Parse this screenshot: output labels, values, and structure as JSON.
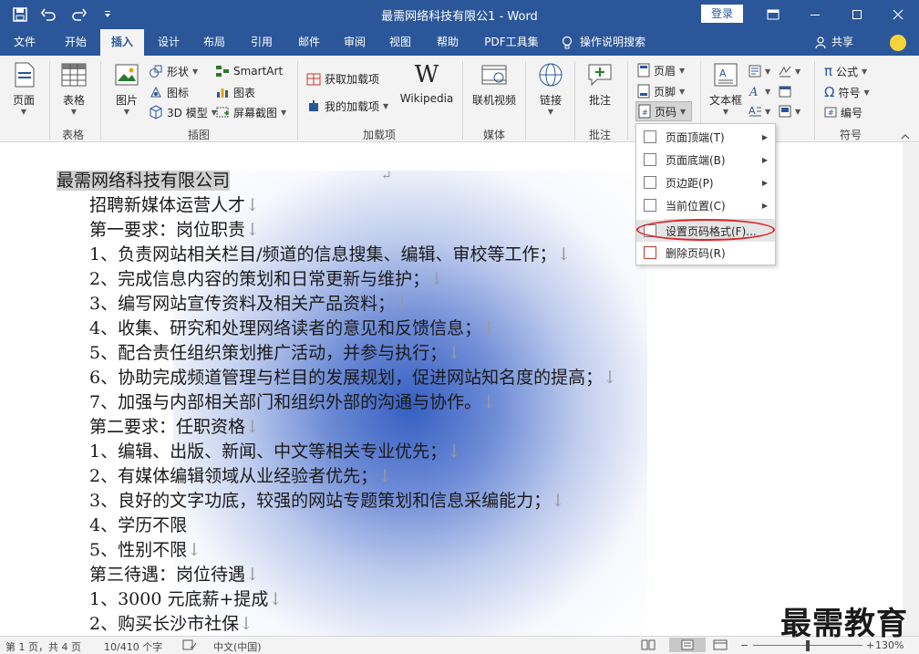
{
  "window": {
    "title": "最需网络科技有限公1 - Word",
    "login_label": "登录"
  },
  "tabs": [
    {
      "label": "文件"
    },
    {
      "label": "开始"
    },
    {
      "label": "插入"
    },
    {
      "label": "设计"
    },
    {
      "label": "布局"
    },
    {
      "label": "引用"
    },
    {
      "label": "邮件"
    },
    {
      "label": "审阅"
    },
    {
      "label": "视图"
    },
    {
      "label": "帮助"
    },
    {
      "label": "PDF工具集"
    }
  ],
  "tell_me": "操作说明搜索",
  "share": "共享",
  "ribbon": {
    "pages": {
      "label": "页面",
      "group": ""
    },
    "table": {
      "label": "表格",
      "group": "表格"
    },
    "picture": {
      "label": "图片"
    },
    "shapes": "形状",
    "icons": "图标",
    "model3d": "3D 模型",
    "smartart": "SmartArt",
    "chart": "图表",
    "screenshot": "屏幕截图",
    "illustrations_group": "插图",
    "get_addins": "获取加载项",
    "my_addins": "我的加载项",
    "wikipedia": "Wikipedia",
    "addins_group": "加载项",
    "online_video": "联机视频",
    "media_group": "媒体",
    "link": "链接",
    "comment": "批注",
    "comment_group": "批注",
    "header": "页眉",
    "footer": "页脚",
    "page_number": "页码",
    "textbox": "文本框",
    "equation": "公式",
    "symbol": "符号",
    "numbering": "编号",
    "symbols_group": "符号"
  },
  "menu": {
    "items": [
      {
        "label": "页面顶端(T)",
        "submenu": true
      },
      {
        "label": "页面底端(B)",
        "submenu": true
      },
      {
        "label": "页边距(P)",
        "submenu": true
      },
      {
        "label": "当前位置(C)",
        "submenu": true
      },
      {
        "label": "设置页码格式(F)...",
        "submenu": false
      },
      {
        "label": "删除页码(R)",
        "submenu": false
      }
    ]
  },
  "document": {
    "lines": [
      "最需网络科技有限公司",
      "招聘新媒体运营人才",
      "第一要求：岗位职责",
      "1、负责网站相关栏目/频道的信息搜集、编辑、审校等工作；",
      "2、完成信息内容的策划和日常更新与维护；",
      "3、编写网站宣传资料及相关产品资料；",
      "4、收集、研究和处理网络读者的意见和反馈信息；",
      "5、配合责任组织策划推广活动，并参与执行；",
      "6、协助完成频道管理与栏目的发展规划，促进网站知名度的提高；",
      "7、加强与内部相关部门和组织外部的沟通与协作。",
      "第二要求：任职资格",
      "1、编辑、出版、新闻、中文等相关专业优先；",
      "2、有媒体编辑领域从业经验者优先；",
      "3、良好的文字功底，较强的网站专题策划和信息采编能力；",
      "4、学历不限",
      "5、性别不限",
      "第三待遇：岗位待遇",
      "1、3000 元底薪+提成",
      "2、购买长沙市社保"
    ]
  },
  "status": {
    "page": "第 1 页，共 4 页",
    "words": "10/410 个字",
    "language": "中文(中国)",
    "zoom": "130%"
  },
  "watermark": "最需教育",
  "colors": {
    "accent": "#2b579a",
    "highlight_ring": "#d9262a"
  }
}
